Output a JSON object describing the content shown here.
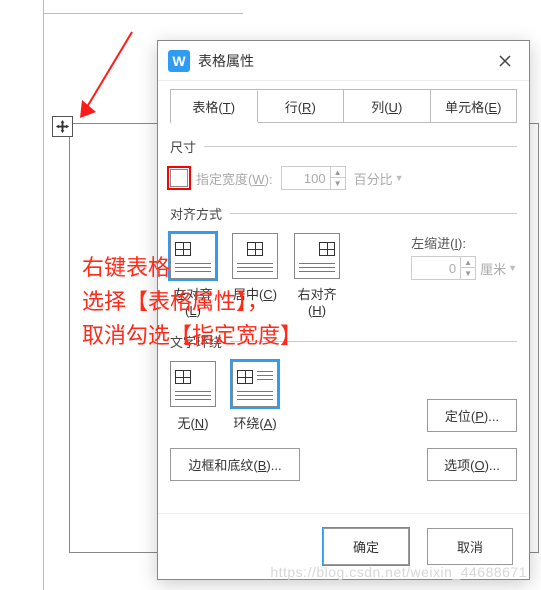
{
  "dialog": {
    "title": "表格属性",
    "app_icon_letter": "W",
    "tabs": [
      {
        "label_pre": "表格(",
        "key": "T",
        "label_post": ")"
      },
      {
        "label_pre": "行(",
        "key": "R",
        "label_post": ")"
      },
      {
        "label_pre": "列(",
        "key": "U",
        "label_post": ")"
      },
      {
        "label_pre": "单元格(",
        "key": "E",
        "label_post": ")"
      }
    ],
    "size": {
      "group": "尺寸",
      "checkbox_label_pre": "指定宽度(",
      "checkbox_key": "W",
      "checkbox_label_post": "):",
      "width_value": "100",
      "unit_label": "百分比"
    },
    "align": {
      "group": "对齐方式",
      "options": [
        {
          "name": "left",
          "label_pre": "左对齐(",
          "key": "L",
          "label_post": ")"
        },
        {
          "name": "center",
          "label_pre": "居中(",
          "key": "C",
          "label_post": ")"
        },
        {
          "name": "right",
          "label_pre": "右对齐(",
          "key": "H",
          "label_post": ")"
        }
      ],
      "indent_label_pre": "左缩进(",
      "indent_key": "I",
      "indent_label_post": "):",
      "indent_value": "0",
      "indent_unit": "厘米"
    },
    "wrap": {
      "group": "文字环绕",
      "options": [
        {
          "name": "none",
          "label_pre": "无(",
          "key": "N",
          "label_post": ")"
        },
        {
          "name": "around",
          "label_pre": "环绕(",
          "key": "A",
          "label_post": ")"
        }
      ],
      "position_btn_pre": "定位(",
      "position_key": "P",
      "position_btn_post": ")..."
    },
    "bottom": {
      "border_btn_pre": "边框和底纹(",
      "border_key": "B",
      "border_btn_post": ")...",
      "options_btn_pre": "选项(",
      "options_key": "O",
      "options_btn_post": ")..."
    },
    "footer": {
      "ok": "确定",
      "cancel": "取消"
    }
  },
  "annotation": {
    "line1": "右键表格",
    "line2": "选择【表格属性】，",
    "line3": "取消勾选【指定宽度】"
  },
  "watermark": "https://blog.csdn.net/weixin_44688671"
}
